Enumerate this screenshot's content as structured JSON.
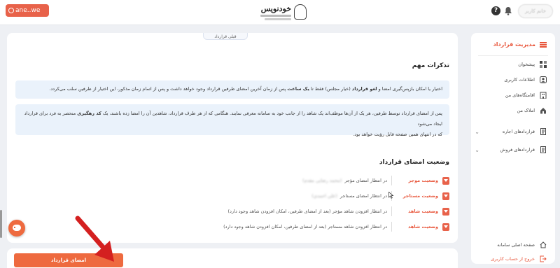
{
  "watermark": {
    "label": "ane..we"
  },
  "header": {
    "logo_text": "خودنویس",
    "help_symbol": "?",
    "user_label": "خانم کاربر"
  },
  "sidebar": {
    "title": "مدیریت قرارداد",
    "items": [
      {
        "label": "پیشخوان",
        "icon": "dashboard-icon"
      },
      {
        "label": "اطلاعات کاربری",
        "icon": "user-icon"
      },
      {
        "label": "اقامتگاه‌های من",
        "icon": "building-icon"
      },
      {
        "label": "املاک من",
        "icon": "house-icon"
      },
      {
        "label": "قراردادهای اجاره",
        "icon": "document-icon",
        "expandable": true
      },
      {
        "label": "قراردادهای فروش",
        "icon": "document-icon",
        "expandable": true
      }
    ],
    "footer_items": [
      {
        "label": "صفحه اصلی سامانه",
        "icon": "home-icon"
      },
      {
        "label": "خروج از حساب کاربری",
        "icon": "logout-icon"
      }
    ]
  },
  "main": {
    "tab_stub": "قبلی قرارداد",
    "notes_title": "تذکرات مهم",
    "note1": {
      "p1": "اختیار یا امکان بازپس‌گیری امضا و ",
      "b1": "لغو قرارداد",
      "p2": " (خیار مجلس) فقط تا ",
      "b2": "یک ساعت",
      "p3": " پس از زمان آخرین امضای طرفین قرارداد وجود خواهد داشت و پس از اتمام زمان مذکور، این اختیار از طرفین سلب می‌کردد."
    },
    "note2": {
      "line1": "پس از امضای قرارداد توسط طرفین، هر یک از آن‌ها موظف‌اند یک شاهد را از جانب خود به سامانه معرفی نمایند. هنگامی که از هر طرف قرارداد، شاهدین آن را امضا زده باشند، یک ",
      "b1": "کد رهگیری",
      "line1_end": " منحصر به فرد برای قرارداد ایجاد می‌شود",
      "line2": "که در انتهای همین صفحه قابل رؤیت خواهد بود."
    },
    "status_title": "وضعیت امضای قرارداد",
    "signatures": [
      {
        "label": "وضعیت موجر",
        "status": "در انتظار امضای مؤجر",
        "blurred": "(محمد رضایی مقدم)"
      },
      {
        "label": "وضعیت مستاجر",
        "status": "در انتظار امضای مستاجر",
        "blurred": "(علی احمدی)"
      },
      {
        "label": "وضعیت شاهد",
        "status": "در انتظار افزودن شاهد مؤجر (بعد از امضای طرفین، امکان افزودن شاهد وجود دارد)",
        "blurred": ""
      },
      {
        "label": "وضعیت شاهد",
        "status": "در انتظار افزودن شاهد مستاجر (بعد از امضای طرفین، امکان افزودن شاهد وجود دارد)",
        "blurred": ""
      }
    ]
  },
  "actions": {
    "sign_label": "امضای قرارداد"
  },
  "colors": {
    "accent": "#e8553a",
    "button": "#ee6a3f",
    "note_bg": "#eaf2fb",
    "arrow": "#d42020"
  }
}
